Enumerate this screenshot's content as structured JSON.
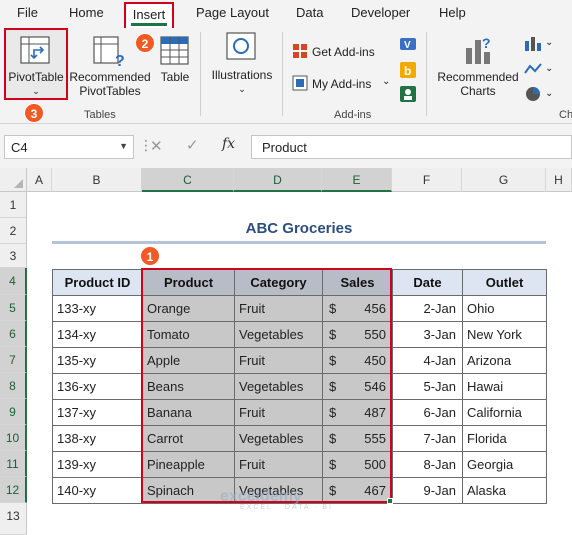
{
  "tabs": [
    "File",
    "Home",
    "Insert",
    "Page Layout",
    "Data",
    "Developer",
    "Help"
  ],
  "active_tab": "Insert",
  "ribbon": {
    "pivottable_label": "PivotTable",
    "recommended_pivottables_line1": "Recommended",
    "recommended_pivottables_line2": "PivotTables",
    "table_label": "Table",
    "illustrations_label": "Illustrations",
    "get_addins_label": "Get Add-ins",
    "my_addins_label": "My Add-ins",
    "recommended_charts_line1": "Recommended",
    "recommended_charts_line2": "Charts",
    "group_tables": "Tables",
    "group_addins": "Add-ins",
    "group_charts_partial": "Ch"
  },
  "badges": {
    "data_range": "1",
    "insert_tab": "2",
    "pivottable": "3"
  },
  "formula_bar": {
    "name_box": "C4",
    "fx": "fx",
    "content": "Product"
  },
  "grid": {
    "columns": [
      "A",
      "B",
      "C",
      "D",
      "E",
      "F",
      "G",
      "H"
    ],
    "rows": [
      "1",
      "2",
      "3",
      "4",
      "5",
      "6",
      "7",
      "8",
      "9",
      "10",
      "11",
      "12",
      "13"
    ]
  },
  "sheet": {
    "title": "ABC Groceries",
    "headers": [
      "Product ID",
      "Product",
      "Category",
      "Sales",
      "Date",
      "Outlet"
    ],
    "currency_symbol": "$",
    "rows": [
      [
        "133-xy",
        "Orange",
        "Fruit",
        "456",
        "2-Jan",
        "Ohio"
      ],
      [
        "134-xy",
        "Tomato",
        "Vegetables",
        "550",
        "3-Jan",
        "New York"
      ],
      [
        "135-xy",
        "Apple",
        "Fruit",
        "450",
        "4-Jan",
        "Arizona"
      ],
      [
        "136-xy",
        "Beans",
        "Vegetables",
        "546",
        "5-Jan",
        "Hawai"
      ],
      [
        "137-xy",
        "Banana",
        "Fruit",
        "487",
        "6-Jan",
        "California"
      ],
      [
        "138-xy",
        "Carrot",
        "Vegetables",
        "555",
        "7-Jan",
        "Florida"
      ],
      [
        "139-xy",
        "Pineapple",
        "Fruit",
        "500",
        "8-Jan",
        "Georgia"
      ],
      [
        "140-xy",
        "Spinach",
        "Vegetables",
        "467",
        "9-Jan",
        "Alaska"
      ]
    ]
  },
  "watermark": {
    "name": "exceldemy",
    "tagline": "EXCEL · DATA · BI"
  },
  "colors": {
    "accent_green": "#217346",
    "highlight_red": "#d0021b",
    "badge_orange": "#f15a24",
    "title_blue": "#2e4f7e"
  }
}
